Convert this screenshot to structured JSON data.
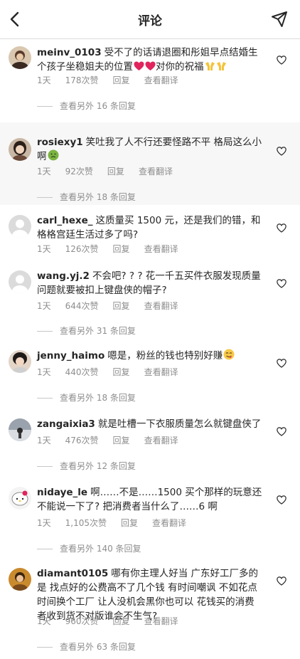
{
  "header": {
    "title": "评论",
    "back_icon": "back-chevron-icon",
    "send_icon": "send-icon"
  },
  "comments": [
    {
      "username": "meinv_0103",
      "text": "受不了的话请退圈和彤姐早点结婚生个孩子坐稳姐夫的位置",
      "text_suffix": "对你的祝福",
      "emojis_mid": [
        "red-heart-icon",
        "red-heart-icon"
      ],
      "emojis_end": [
        "raising-hands-icon",
        "raising-hands-icon"
      ],
      "time": "1天",
      "likes": "178次赞",
      "reply": "回复",
      "translate": "查看翻译",
      "view_replies": "查看另外 16 条回复"
    },
    {
      "username": "rosiexy1",
      "text": "笑吐我了人不行还要怪路不平 格局这么小啊",
      "emojis_end": [
        "nauseated-face-icon"
      ],
      "time": "1天",
      "likes": "92次赞",
      "reply": "回复",
      "translate": "查看翻译",
      "view_replies": "查看另外 18 条回复"
    },
    {
      "username": "carl_hexe_",
      "text": "这质量买 1500 元，还是我们的错，和格格宫廷生活过多了吗?",
      "time": "1天",
      "likes": "126次赞",
      "reply": "回复",
      "translate": "查看翻译"
    },
    {
      "username": "wang.yj.2",
      "text": "不会吧? ? ? 花一千五买件衣服发现质量问题就要被扣上键盘侠的帽子?",
      "time": "1天",
      "likes": "644次赞",
      "reply": "回复",
      "translate": "查看翻译",
      "view_replies": "查看另外 31 条回复"
    },
    {
      "username": "jenny_haimo",
      "text": "嗯是，粉丝的钱也特别好赚",
      "emojis_end": [
        "savoring-face-icon"
      ],
      "time": "1天",
      "likes": "440次赞",
      "reply": "回复",
      "translate": "查看翻译",
      "view_replies": "查看另外 18 条回复"
    },
    {
      "username": "zangaixia3",
      "text": "就是吐槽一下衣服质量怎么就键盘侠了",
      "time": "1天",
      "likes": "476次赞",
      "reply": "回复",
      "translate": "查看翻译",
      "view_replies": "查看另外 12 条回复"
    },
    {
      "username": "nidaye_le",
      "text": "啊……不是……1500 买个那样的玩意还不能说一下了? 把消费者当什么了……6 啊",
      "time": "1天",
      "likes": "1,105次赞",
      "reply": "回复",
      "translate": "查看翻译",
      "view_replies": "查看另外 140 条回复"
    },
    {
      "username": "diamant0105",
      "text": "哪有你主理人好当 广东好工厂多的是 找点好的公费高不了几个钱 有时间嘲讽 不如花点时间换个工厂 让人没机会黑你也可以 花钱买的消费者收到货不对版谁会不生气?",
      "time": "1天",
      "likes": "960次赞",
      "reply": "回复",
      "translate": "查看翻译",
      "view_replies": "查看另外 63 条回复"
    }
  ],
  "colors": {
    "text": "#262626",
    "secondary": "#8e8e8e",
    "divider": "#dbdbdb",
    "shaded_bg": "#f7f7f7",
    "heart_red": "#ed4956"
  }
}
